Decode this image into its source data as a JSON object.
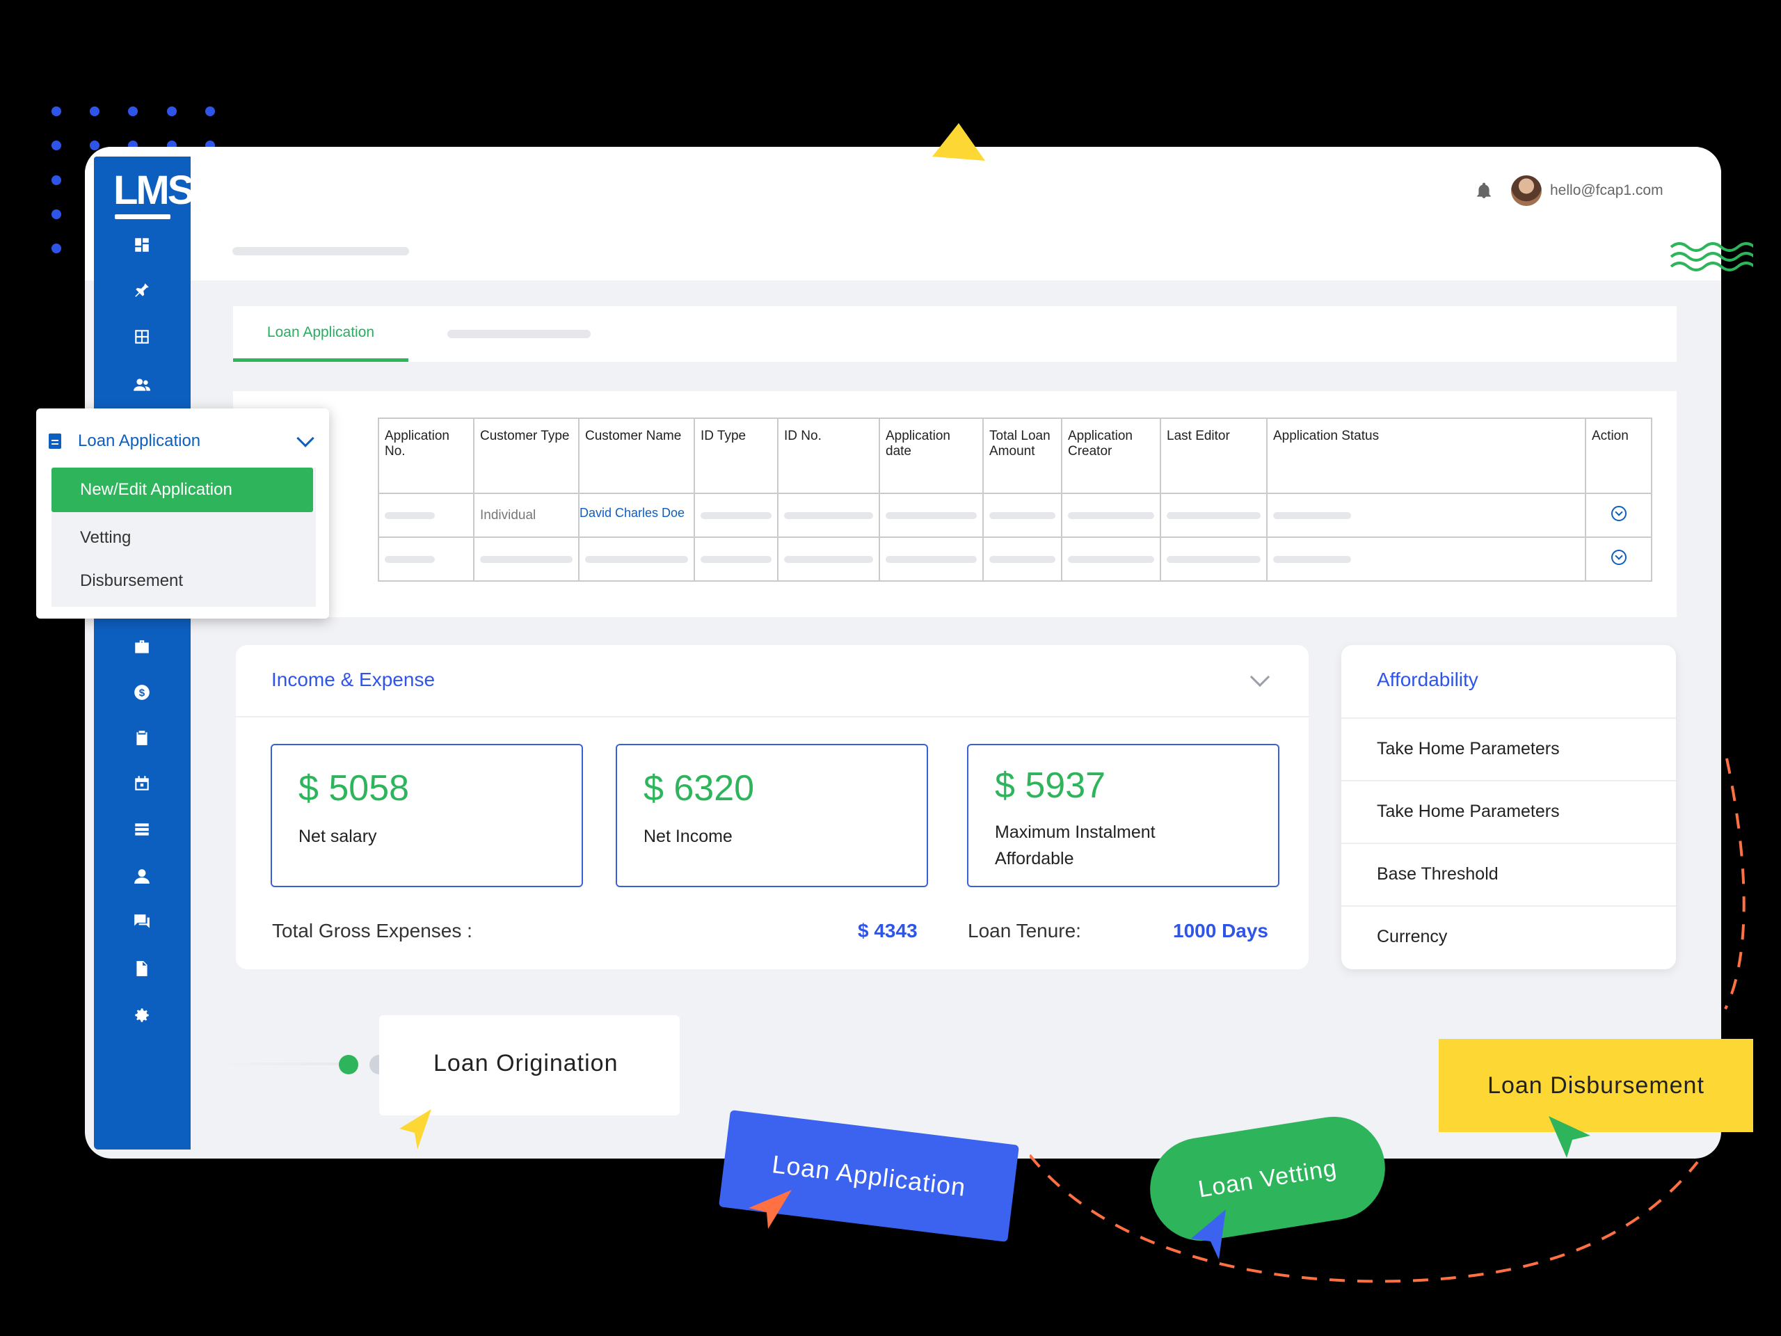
{
  "app": {
    "logo_text": "LMS"
  },
  "header": {
    "user_email": "hello@fcap1.com"
  },
  "sidebar": {
    "icons": [
      "dashboard-icon",
      "pin-icon",
      "grid-icon",
      "users-icon",
      "briefcase-icon",
      "dollar-icon",
      "clipboard-icon",
      "calendar-icon",
      "list-icon",
      "person-icon",
      "chat-icon",
      "file-icon",
      "settings-icon"
    ]
  },
  "tabs": [
    {
      "label": "Loan Application",
      "active": true
    }
  ],
  "menu": {
    "title": "Loan Application",
    "items": [
      {
        "label": "New/Edit Application",
        "active": true
      },
      {
        "label": "Vetting",
        "active": false
      },
      {
        "label": "Disbursement",
        "active": false
      }
    ]
  },
  "table": {
    "columns": [
      "Application No.",
      "Customer Type",
      "Customer Name",
      "ID Type",
      "ID No.",
      "Application date",
      "Total Loan Amount",
      "Application Creator",
      "Last Editor",
      "Application Status",
      "Action"
    ],
    "rows": [
      {
        "customer_type": "Individual",
        "customer_name": "David Charles Doe"
      },
      {
        "customer_type": "",
        "customer_name": ""
      }
    ]
  },
  "income": {
    "title": "Income & Expense",
    "cards": [
      {
        "amount": "$ 5058",
        "caption": "Net salary"
      },
      {
        "amount": "$ 6320",
        "caption": "Net Income"
      },
      {
        "amount": "$ 5937",
        "caption": "Maximum Instalment Affordable"
      }
    ],
    "total_gross_label": "Total Gross Expenses :",
    "total_gross_value": "$ 4343",
    "tenure_label": "Loan Tenure:",
    "tenure_value": "1000 Days"
  },
  "affordability": {
    "title": "Affordability",
    "items": [
      "Take Home Parameters",
      "Take Home Parameters",
      "Base Threshold",
      "Currency"
    ]
  },
  "flow": {
    "origination": "Loan Origination",
    "application": "Loan Application",
    "vetting": "Loan Vetting",
    "disbursement": "Loan Disbursement"
  },
  "colors": {
    "sidebar_blue": "#0d5fbf",
    "accent_green": "#2eb55c",
    "accent_blue": "#2f55e8",
    "pill_yellow": "#fdd835",
    "dash_orange": "#ff7043"
  }
}
